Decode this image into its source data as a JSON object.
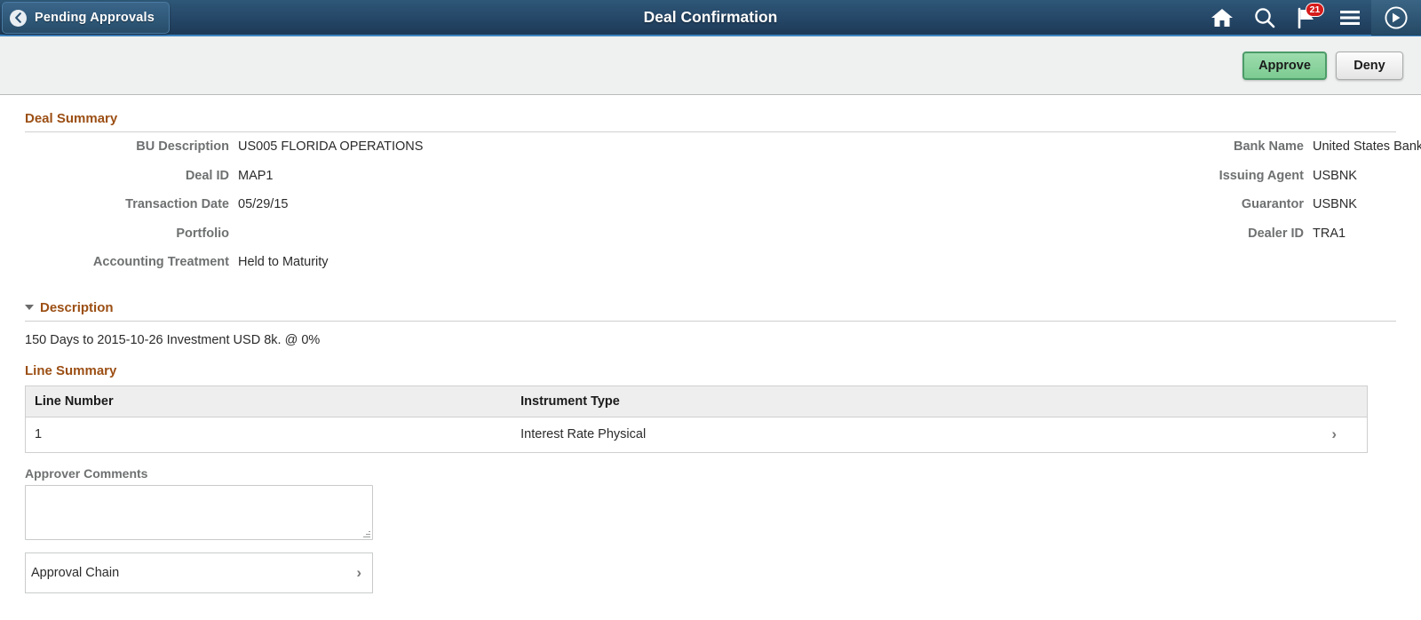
{
  "header": {
    "back_button_label": "Pending Approvals",
    "title": "Deal Confirmation",
    "icons": [
      {
        "name": "home-icon",
        "label": "Home"
      },
      {
        "name": "search-icon",
        "label": "Search"
      },
      {
        "name": "notifications-flag-icon",
        "label": "Notifications",
        "badge": "21"
      },
      {
        "name": "actions-menu-icon",
        "label": "Actions Menu"
      },
      {
        "name": "navigator-icon",
        "label": "Navigator"
      }
    ],
    "notification_badge": "21",
    "accent_color": "#3f86c4",
    "bar_color": "#27496a"
  },
  "toolbar": {
    "approve_label": "Approve",
    "deny_label": "Deny",
    "approve_color": "#7ccb92",
    "deny_color": "#e4e4e4"
  },
  "deal_summary": {
    "heading": "Deal Summary",
    "left_fields": [
      {
        "label": "BU Description",
        "value": "US005 FLORIDA OPERATIONS"
      },
      {
        "label": "Deal ID",
        "value": "MAP1"
      },
      {
        "label": "Transaction Date",
        "value": "05/29/15"
      },
      {
        "label": "Portfolio",
        "value": ""
      },
      {
        "label": "Accounting Treatment",
        "value": "Held to Maturity"
      }
    ],
    "right_fields": [
      {
        "label": "Bank Name",
        "value": "United States Bank"
      },
      {
        "label": "Issuing Agent",
        "value": "USBNK"
      },
      {
        "label": "Guarantor",
        "value": "USBNK"
      },
      {
        "label": "Dealer ID",
        "value": "TRA1"
      }
    ]
  },
  "description": {
    "heading": "Description",
    "text": "150 Days to 2015-10-26 Investment USD 8k. @ 0%",
    "expanded": true
  },
  "line_summary": {
    "heading": "Line Summary",
    "columns": [
      "Line Number",
      "Instrument Type",
      ""
    ],
    "rows": [
      {
        "line_number": "1",
        "instrument_type": "Interest Rate Physical",
        "chevron": "›"
      }
    ]
  },
  "approver_comments": {
    "label": "Approver Comments",
    "value": "",
    "placeholder": ""
  },
  "approval_chain": {
    "label": "Approval Chain",
    "chevron": "›"
  },
  "section_heading_color": "#9c4f14"
}
